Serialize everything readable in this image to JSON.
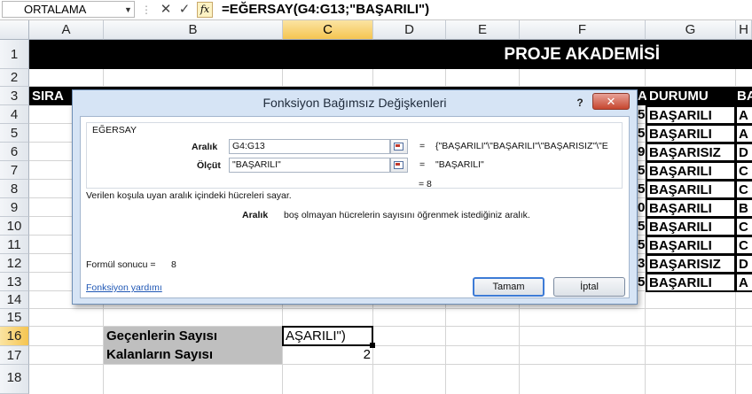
{
  "formula_bar": {
    "name_box": "ORTALAMA",
    "cancel_glyph": "✕",
    "enter_glyph": "✓",
    "fx_label": "fx",
    "formula": "=EĞERSAY(G4:G13;\"BAŞARILI\")"
  },
  "columns": [
    "A",
    "B",
    "C",
    "D",
    "E",
    "F",
    "G",
    "H"
  ],
  "rows": [
    "1",
    "2",
    "3",
    "4",
    "5",
    "6",
    "7",
    "8",
    "9",
    "10",
    "11",
    "12",
    "13",
    "14",
    "15",
    "16",
    "17",
    "18"
  ],
  "sheet": {
    "title": "PROJE AKADEMİSİ",
    "sira_header": "SIRA",
    "durumu_header": "DURUMU",
    "h_header": "BA",
    "f_partial_header": "A",
    "d_partial_header": "",
    "f_partial": [
      "5",
      "5",
      "9",
      "5",
      "5",
      "0",
      "5",
      "5",
      "3",
      "5"
    ],
    "durumu": [
      "BAŞARILI",
      "BAŞARILI",
      "BAŞARISIZ",
      "BAŞARILI",
      "BAŞARILI",
      "BAŞARILI",
      "BAŞARILI",
      "BAŞARILI",
      "BAŞARISIZ",
      "BAŞARILI"
    ],
    "h_col": [
      "A",
      "A",
      "D",
      "C",
      "C",
      "B",
      "C",
      "C",
      "D",
      "A"
    ],
    "gecenler_label": "Geçenlerin Sayısı",
    "kalanlar_label": "Kalanların Sayısı",
    "c16_value": "AŞARILI\")",
    "c17_value": "2",
    "colors": {
      "title_bg": "#000000",
      "title_fg": "#ffffff",
      "label_bg": "#bfbfbf",
      "select_hdr": "#f5c551"
    }
  },
  "dialog": {
    "title": "Fonksiyon Bağımsız Değişkenleri",
    "help_glyph": "?",
    "close_glyph": "✕",
    "function_name": "EĞERSAY",
    "arg1_label": "Aralık",
    "arg1_value": "G4:G13",
    "arg1_result": "{\"BAŞARILI\"\\\"BAŞARILI\"\\\"BAŞARISIZ\"\\\"E",
    "arg2_label": "Ölçüt",
    "arg2_value": "\"BAŞARILI\"",
    "arg2_result": "\"BAŞARILI\"",
    "eq": "=",
    "result_value": "= 8",
    "description": "Verilen koşula uyan aralık içindeki hücreleri sayar.",
    "arg_help_label": "Aralık",
    "arg_help_text": "boş olmayan hücrelerin sayısını öğrenmek istediğiniz aralık.",
    "formula_result_label": "Formül sonucu =",
    "formula_result_value": "8",
    "help_link": "Fonksiyon yardımı",
    "ok_label": "Tamam",
    "cancel_label": "İptal"
  }
}
